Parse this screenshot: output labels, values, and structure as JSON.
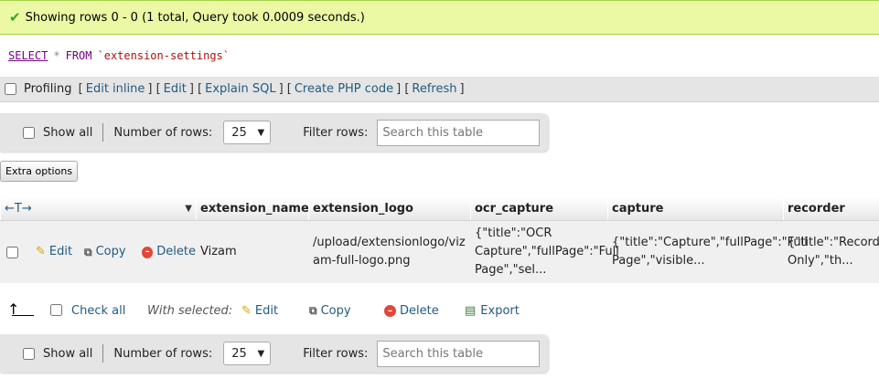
{
  "success": {
    "message": "Showing rows 0 - 0 (1 total, Query took 0.0009 seconds.)"
  },
  "sql": {
    "select": "SELECT",
    "star": "*",
    "from": "FROM",
    "table": "`extension-settings`"
  },
  "profiling": {
    "label": "Profiling",
    "links": [
      "Edit inline",
      "Edit",
      "Explain SQL",
      "Create PHP code",
      "Refresh"
    ]
  },
  "nav": {
    "show_all": "Show all",
    "number_of_rows": "Number of rows:",
    "rows_value": "25",
    "filter_rows": "Filter rows:",
    "search_placeholder": "Search this table"
  },
  "extra_options": "Extra options",
  "table": {
    "columns": [
      "extension_name",
      "extension_logo",
      "ocr_capture",
      "capture",
      "recorder"
    ],
    "row_actions": {
      "edit": "Edit",
      "copy": "Copy",
      "delete": "Delete"
    },
    "row": {
      "extension_name": "Vizam",
      "extension_logo": "/upload/extensionlogo/vizam-full-logo.png",
      "ocr_capture_l1": "{\"title\":\"OCR",
      "ocr_capture_l2": "Capture\",\"fullPage\":\"Full",
      "ocr_capture_l3": "Page\",\"sel...",
      "capture_l1": "{\"title\":\"Capture\",\"fullPage\":\"Full",
      "capture_l2": "Page\",\"visible...",
      "recorder_l1": "{\"title\":\"Recorder\"",
      "recorder_l2": "Only\",\"th..."
    }
  },
  "with_selected": {
    "check_all": "Check all",
    "label": "With selected:",
    "edit": "Edit",
    "copy": "Copy",
    "delete": "Delete",
    "export": "Export"
  }
}
